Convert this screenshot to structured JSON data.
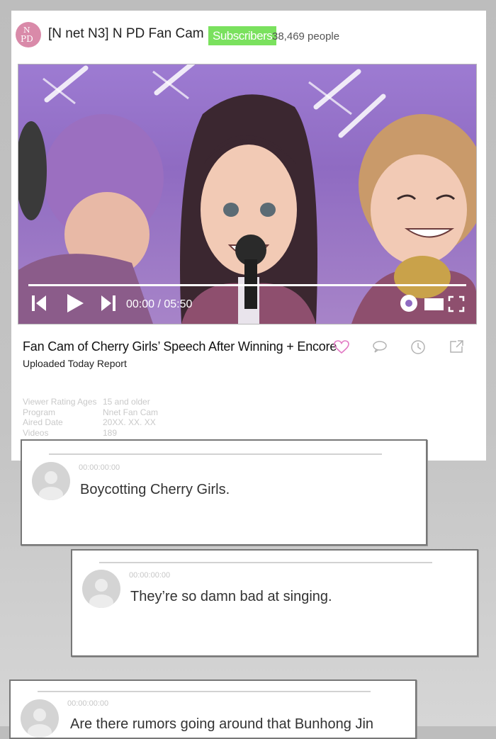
{
  "channel": {
    "logo_line1": "N",
    "logo_line2": "PD",
    "name": "[N net N3] N PD Fan Cam",
    "subscribers_label": "Subscribers",
    "subscribers_count": "38,469 people"
  },
  "player": {
    "time": "00:00 / 05:50",
    "progress": 0
  },
  "video": {
    "title": "Fan Cam of Cherry Girls’ Speech After Winning + Encore",
    "subline": "Uploaded Today Report"
  },
  "info": [
    {
      "key": "Viewer Rating Ages",
      "value": "15 and older"
    },
    {
      "key": "Program",
      "value": "Nnet Fan Cam"
    },
    {
      "key": "Aired Date",
      "value": "20XX. XX. XX"
    },
    {
      "key": "Videos",
      "value": "189"
    }
  ],
  "comments": [
    {
      "timestamp": "00:00:00:00",
      "text": "Boycotting Cherry Girls."
    },
    {
      "timestamp": "00:00:00:00",
      "text": "They’re so damn bad at singing."
    },
    {
      "timestamp": "00:00:00:00",
      "text": "Are there rumors going around that Bunhong Jin"
    }
  ],
  "colors": {
    "subscribers_badge": "#7ae15e",
    "heart": "#e27ac4",
    "logo": "#d98aa9"
  }
}
